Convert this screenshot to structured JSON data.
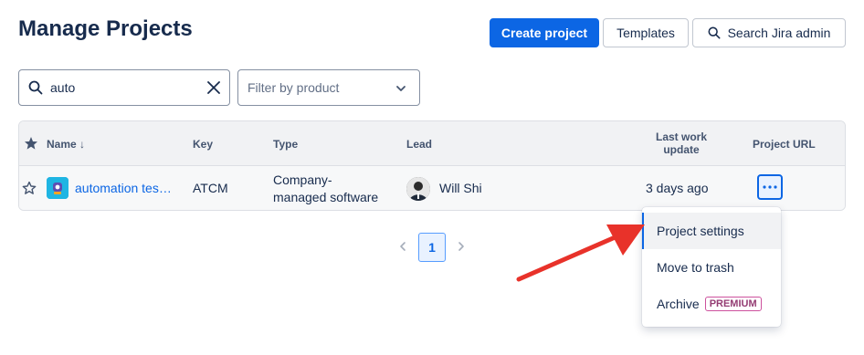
{
  "header": {
    "title": "Manage Projects",
    "create_label": "Create project",
    "templates_label": "Templates",
    "search_admin_label": "Search Jira admin"
  },
  "search": {
    "value": "auto"
  },
  "filter": {
    "placeholder": "Filter by product"
  },
  "table": {
    "columns": {
      "name": "Name ↓",
      "key": "Key",
      "type": "Type",
      "lead": "Lead",
      "last_update_1": "Last work",
      "last_update_2": "update",
      "url": "Project URL"
    },
    "rows": [
      {
        "name": "automation tes…",
        "key": "ATCM",
        "type_1": "Company-",
        "type_2": "managed software",
        "lead": "Will Shi",
        "last_update": "3 days ago"
      }
    ]
  },
  "pagination": {
    "current": "1"
  },
  "menu": {
    "items": [
      "Project settings",
      "Move to trash",
      "Archive"
    ],
    "premium_label": "PREMIUM"
  },
  "colors": {
    "primary": "#0C66E4",
    "annotation_arrow": "#E8322A"
  }
}
